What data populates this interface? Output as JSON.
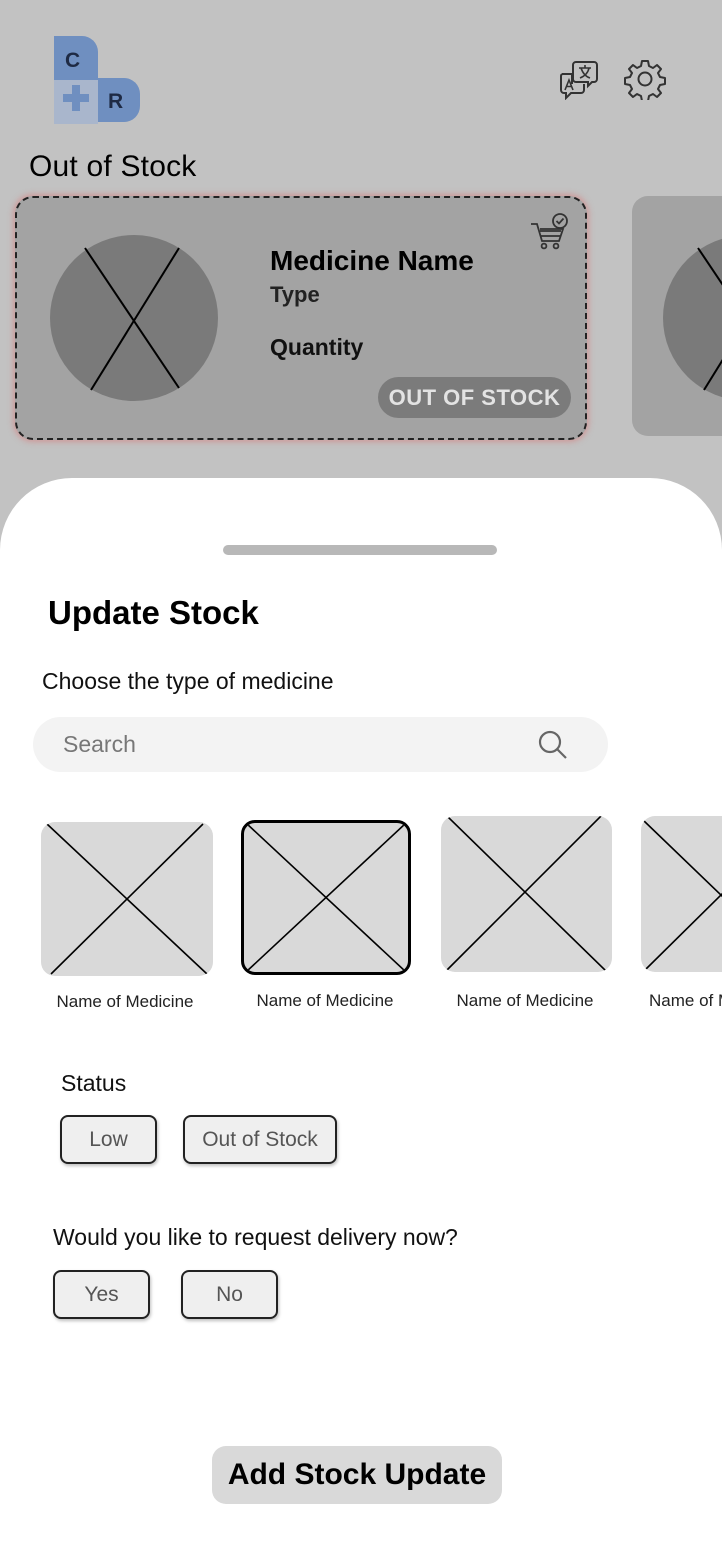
{
  "header": {
    "logo_letters": [
      "C",
      "R"
    ],
    "icons": [
      "translate-icon",
      "gear-icon"
    ]
  },
  "section_title": "Out of Stock",
  "card": {
    "name": "Medicine Name",
    "type": "Type",
    "quantity": "Quantity",
    "badge": "OUT OF STOCK",
    "icon": "cart-check-icon"
  },
  "sheet": {
    "title": "Update Stock",
    "choose_label": "Choose the type of medicine",
    "search": {
      "placeholder": "Search",
      "icon": "search-icon"
    },
    "medicines": [
      {
        "label": "Name of Medicine",
        "selected": false
      },
      {
        "label": "Name of Medicine",
        "selected": true
      },
      {
        "label": "Name of Medicine",
        "selected": false
      },
      {
        "label": "Name of Medicine",
        "selected": false
      }
    ],
    "status": {
      "label": "Status",
      "options": [
        "Low",
        "Out of Stock"
      ]
    },
    "delivery": {
      "label": "Would you like to request delivery now?",
      "options": [
        "Yes",
        "No"
      ]
    },
    "submit_label": "Add Stock Update"
  }
}
